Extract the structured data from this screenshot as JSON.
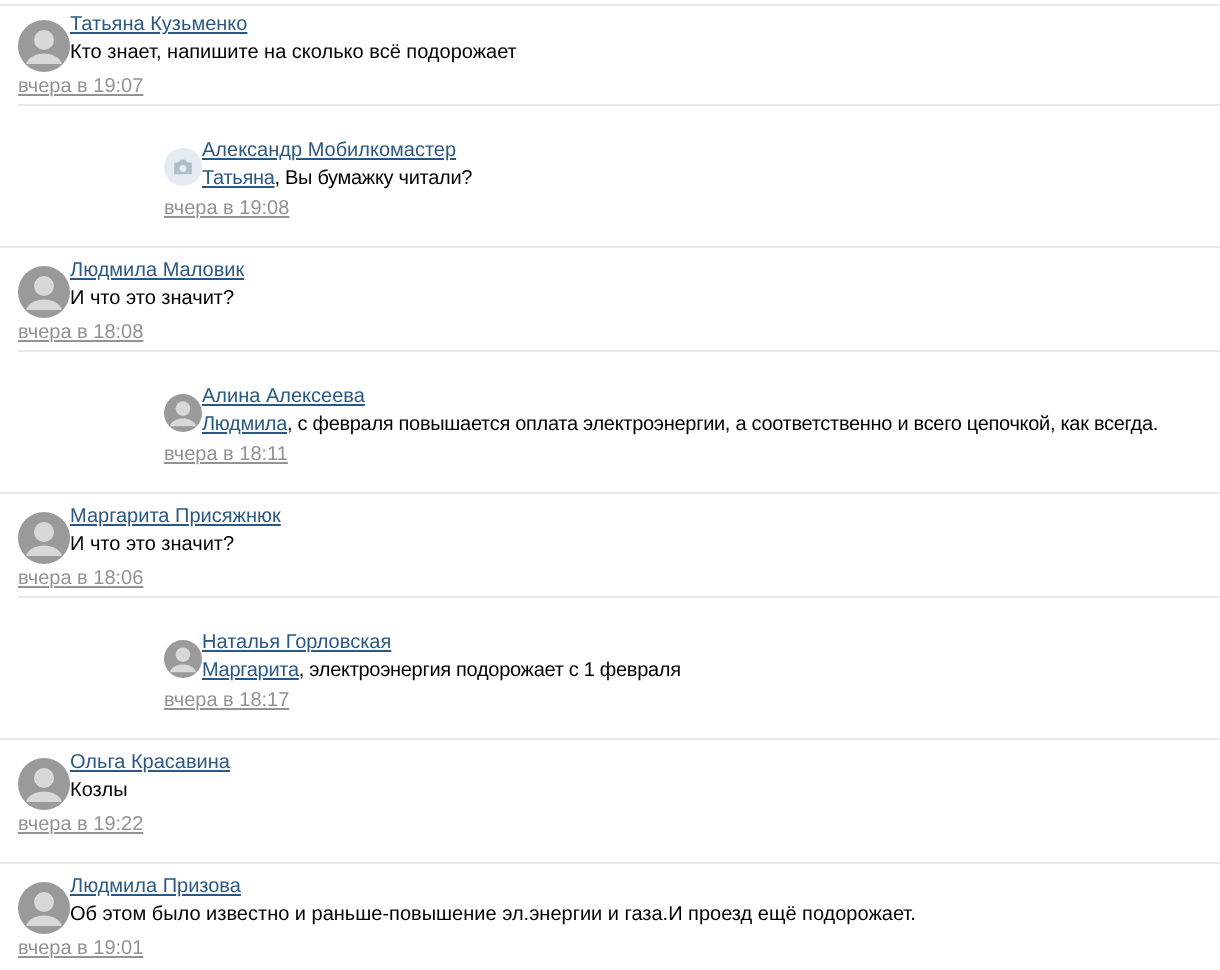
{
  "comments": [
    {
      "author": "Татьяна Кузьменко",
      "avatar": {
        "kind": "photo"
      },
      "text": "Кто знает, напишите на сколько всё подорожает",
      "time": "вчера в 19:07",
      "children": [
        {
          "author": "Александр Мобилкомастер",
          "avatar": {
            "kind": "no-photo"
          },
          "mention": "Татьяна",
          "text": ", Вы бумажку читали?",
          "time": "вчера в 19:08"
        }
      ]
    },
    {
      "author": "Людмила Маловик",
      "avatar": {
        "kind": "photo"
      },
      "text": "И что это значит?",
      "time": "вчера в 18:08",
      "children": [
        {
          "author": "Алина Алексеева",
          "avatar": {
            "kind": "photo"
          },
          "mention": "Людмила",
          "text": ", с февраля повышается оплата электроэнергии, а соответственно и всего цепочкой, как всегда.",
          "time": "вчера в 18:11"
        }
      ]
    },
    {
      "author": "Маргарита Присяжнюк",
      "avatar": {
        "kind": "photo"
      },
      "text": "И что это значит?",
      "time": "вчера в 18:06",
      "children": [
        {
          "author": "Наталья Горловская",
          "avatar": {
            "kind": "photo"
          },
          "mention": "Маргарита",
          "text": ", электроэнергия подорожает с 1 февраля",
          "time": "вчера в 18:17"
        }
      ]
    },
    {
      "author": "Ольга Красавина",
      "avatar": {
        "kind": "photo"
      },
      "text": "Козлы",
      "time": "вчера в 19:22"
    },
    {
      "author": "Людмила Призова",
      "avatar": {
        "kind": "photo"
      },
      "text": "Об этом было известно и раньше-повышение эл.энергии и газа.И проезд ещё подорожает.",
      "time": "вчера в 19:01"
    }
  ]
}
